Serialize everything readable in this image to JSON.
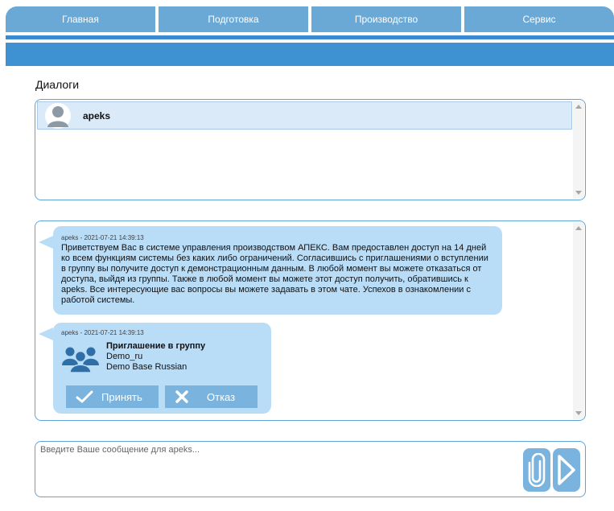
{
  "nav": {
    "tabs": [
      "Главная",
      "Подготовка",
      "Производство",
      "Сервис"
    ]
  },
  "page": {
    "title": "Диалоги"
  },
  "dialogs": [
    {
      "name": "apeks",
      "avatar_icon": "user-avatar-icon"
    }
  ],
  "messages": [
    {
      "author": "apeks",
      "meta": "apeks - 2021-07-21 14:39:13",
      "text": "Приветствуем Вас в системе управления производством АПЕКС. Вам предоставлен доступ на 14 дней ко всем функциям системы без каких либо ограничений. Согласившись с приглашениями о вступлении в группу вы получите доступ к демонстрационным данным. В любой момент вы можете отказаться от доступа, выйдя из группы. Также в любой момент вы можете этот доступ получить, обратившись к apeks. Все интересующие вас вопросы вы можете задавать в этом чате. Успехов в ознакомлении с работой системы."
    },
    {
      "author": "apeks",
      "meta": "apeks - 2021-07-21 14:39:13",
      "invite": {
        "title": "Приглашение в группу",
        "group_code": "Demo_ru",
        "group_name": "Demo Base Russian",
        "icon": "group-users-icon",
        "accept_label": "Принять",
        "decline_label": "Отказ"
      }
    }
  ],
  "composer": {
    "placeholder": "Введите Ваше сообщение для apeks...",
    "attach_icon": "paperclip-icon",
    "send_icon": "play-arrow-icon"
  },
  "colors": {
    "nav_tab": "#6aa8d6",
    "nav_band": "#3f92d2",
    "bubble": "#b9dcf7",
    "button": "#7ab4de",
    "panel_border": "#5fa4d8",
    "selected_item": "#dbeaf8"
  }
}
